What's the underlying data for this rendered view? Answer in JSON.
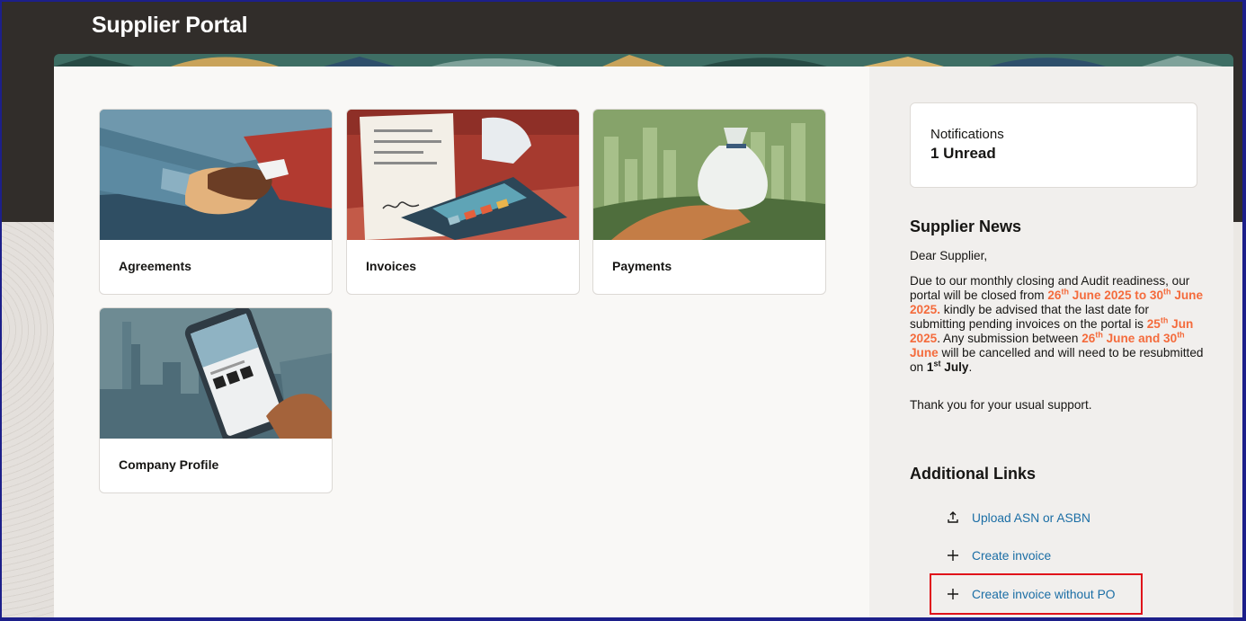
{
  "header": {
    "title": "Supplier Portal"
  },
  "cards": [
    {
      "label": "Agreements"
    },
    {
      "label": "Invoices"
    },
    {
      "label": "Payments"
    },
    {
      "label": "Company Profile"
    }
  ],
  "notifications": {
    "title": "Notifications",
    "count_text": "1 Unread"
  },
  "news": {
    "heading": "Supplier News",
    "greeting": "Dear Supplier,",
    "p_intro": "Due to our monthly closing and Audit readiness, our portal will be closed from",
    "d1_num": "26",
    "d1_sup": "th",
    "d1_rest": " June 2025 to",
    "d2_num": "30",
    "d2_sup": "th",
    "d2_rest": " June 2025.",
    "p_mid": " kindly be advised that the last date for submitting pending invoices on the portal is",
    "d3_num": "25",
    "d3_sup": "th",
    "d3_rest": " Jun 2025",
    "p_mid2": ". Any submission between",
    "d4_num": "26",
    "d4_sup": "th",
    "d4_rest": "June and 30",
    "d5_sup": "th",
    "d5_rest": " June",
    "p_mid3": " will be cancelled and will need to be resubmitted on",
    "d6_num": "1",
    "d6_sup": "st",
    "d6_rest": " July",
    "p_end": ".",
    "thanks": "Thank you for your usual support."
  },
  "additional_links": {
    "heading": "Additional Links",
    "items": [
      {
        "label": "Upload ASN or ASBN",
        "icon": "upload-icon"
      },
      {
        "label": "Create invoice",
        "icon": "plus-icon"
      },
      {
        "label": "Create invoice without PO",
        "icon": "plus-icon"
      }
    ]
  },
  "colors": {
    "header_bg": "#312d2a",
    "link": "#1b6ea5",
    "highlight_date": "#f46b3c",
    "annotation_box": "#e0121a"
  }
}
